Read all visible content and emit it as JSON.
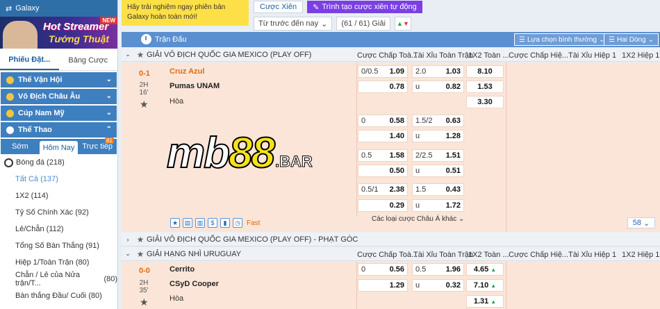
{
  "sidebar": {
    "galaxy": "Galaxy",
    "banner": {
      "line1": "Hot Streamer",
      "line2": "Tướng Thuật",
      "badge": "NEW"
    },
    "tabs": [
      "Phiếu Đặt...",
      "Bảng Cược"
    ],
    "menus": [
      "Thế Vận Hội",
      "Vô Địch Châu Âu",
      "Cúp Nam Mỹ",
      "Thể Thao"
    ],
    "subtabs": [
      "Sớm",
      "Hôm Nay",
      "Trực tiếp"
    ],
    "live_badge": "81",
    "sport": {
      "label": "Bóng đá",
      "count": "(218)"
    },
    "items": [
      {
        "label": "Tất Cả",
        "count": "(137)"
      },
      {
        "label": "1X2",
        "count": "(114)"
      },
      {
        "label": "Tỷ Số Chính Xác",
        "count": "(92)"
      },
      {
        "label": "Lẻ/Chẵn",
        "count": "(112)"
      },
      {
        "label": "Tổng Số Bàn Thắng",
        "count": "(91)"
      },
      {
        "label": "Hiệp 1/Toàn Trận",
        "count": "(80)"
      },
      {
        "label": "Chẵn / Lẻ của Nửa trận/T...",
        "count": "(80)"
      },
      {
        "label": "Bàn thắng Đầu/ Cuối",
        "count": "(80)"
      }
    ]
  },
  "tooltip": "Hãy trải nghiệm ngay phiên bản Galaxy hoàn toàn mới!",
  "topbar": {
    "btn1": "Cược Xiên",
    "btn2": "Trình tạo cược xiên tự động"
  },
  "filters": {
    "order": "Từ trước đến nay",
    "leagues": "(61 / 61) Giải"
  },
  "panel": {
    "title": "Trận Đấu",
    "view": "Lựa chọn bình thường",
    "lines": "Hai Dòng"
  },
  "columns": [
    "Cược Chấp Toà...",
    "Tài Xỉu Toàn Trận",
    "1X2 Toàn ...",
    "Cược Chấp Hiệ...",
    "Tài Xỉu Hiệp 1",
    "1X2 Hiệp 1"
  ],
  "league1": "GIẢI VÔ ĐỊCH QUỐC GIA MEXICO (PLAY OFF)",
  "match1": {
    "score": "0-1",
    "half": "2H",
    "minute": "16'",
    "home": "Cruz Azul",
    "away": "Pumas UNAM",
    "draw": "Hòa",
    "rows": [
      {
        "ah_line": "0/0.5",
        "ah_home": "1.09",
        "ah_away": "0.78",
        "ou_line": "2.0",
        "ou_over": "1.03",
        "ou_under_label": "u",
        "ou_under": "0.82"
      },
      {
        "ah_line": "0",
        "ah_home": "0.58",
        "ah_away": "1.40",
        "ou_line": "1.5/2",
        "ou_over": "0.63",
        "ou_under_label": "u",
        "ou_under": "1.28"
      },
      {
        "ah_line": "0.5",
        "ah_home": "1.58",
        "ah_away": "0.50",
        "ou_line": "2/2.5",
        "ou_over": "1.51",
        "ou_under_label": "u",
        "ou_under": "0.51"
      },
      {
        "ah_line": "0.5/1",
        "ah_home": "2.38",
        "ah_away": "0.29",
        "ou_line": "1.5",
        "ou_over": "0.43",
        "ou_under_label": "u",
        "ou_under": "1.72"
      }
    ],
    "x12": [
      "8.10",
      "1.53",
      "3.30"
    ]
  },
  "tools": {
    "fast": "Fast",
    "more": "Các loại cược Châu Á khác",
    "count": "58"
  },
  "league2": "GIẢI VÔ ĐỊCH QUỐC GIA MEXICO (PLAY OFF) - PHẠT GÓC",
  "league3": "GIẢI HẠNG NHÌ URUGUAY",
  "match2": {
    "score": "0-0",
    "half": "2H",
    "minute": "35'",
    "home": "Cerrito",
    "away": "CSyD Cooper",
    "draw": "Hòa",
    "ah_line": "0",
    "ah_home": "0.56",
    "ah_away": "1.29",
    "ou_line": "0.5",
    "ou_over": "1.96",
    "ou_under_label": "u",
    "ou_under": "0.32",
    "x12": [
      "4.65",
      "7.10",
      "1.31"
    ]
  },
  "logo": {
    "mb": "mb",
    "n88": "88",
    ".bar": ".BAR"
  }
}
